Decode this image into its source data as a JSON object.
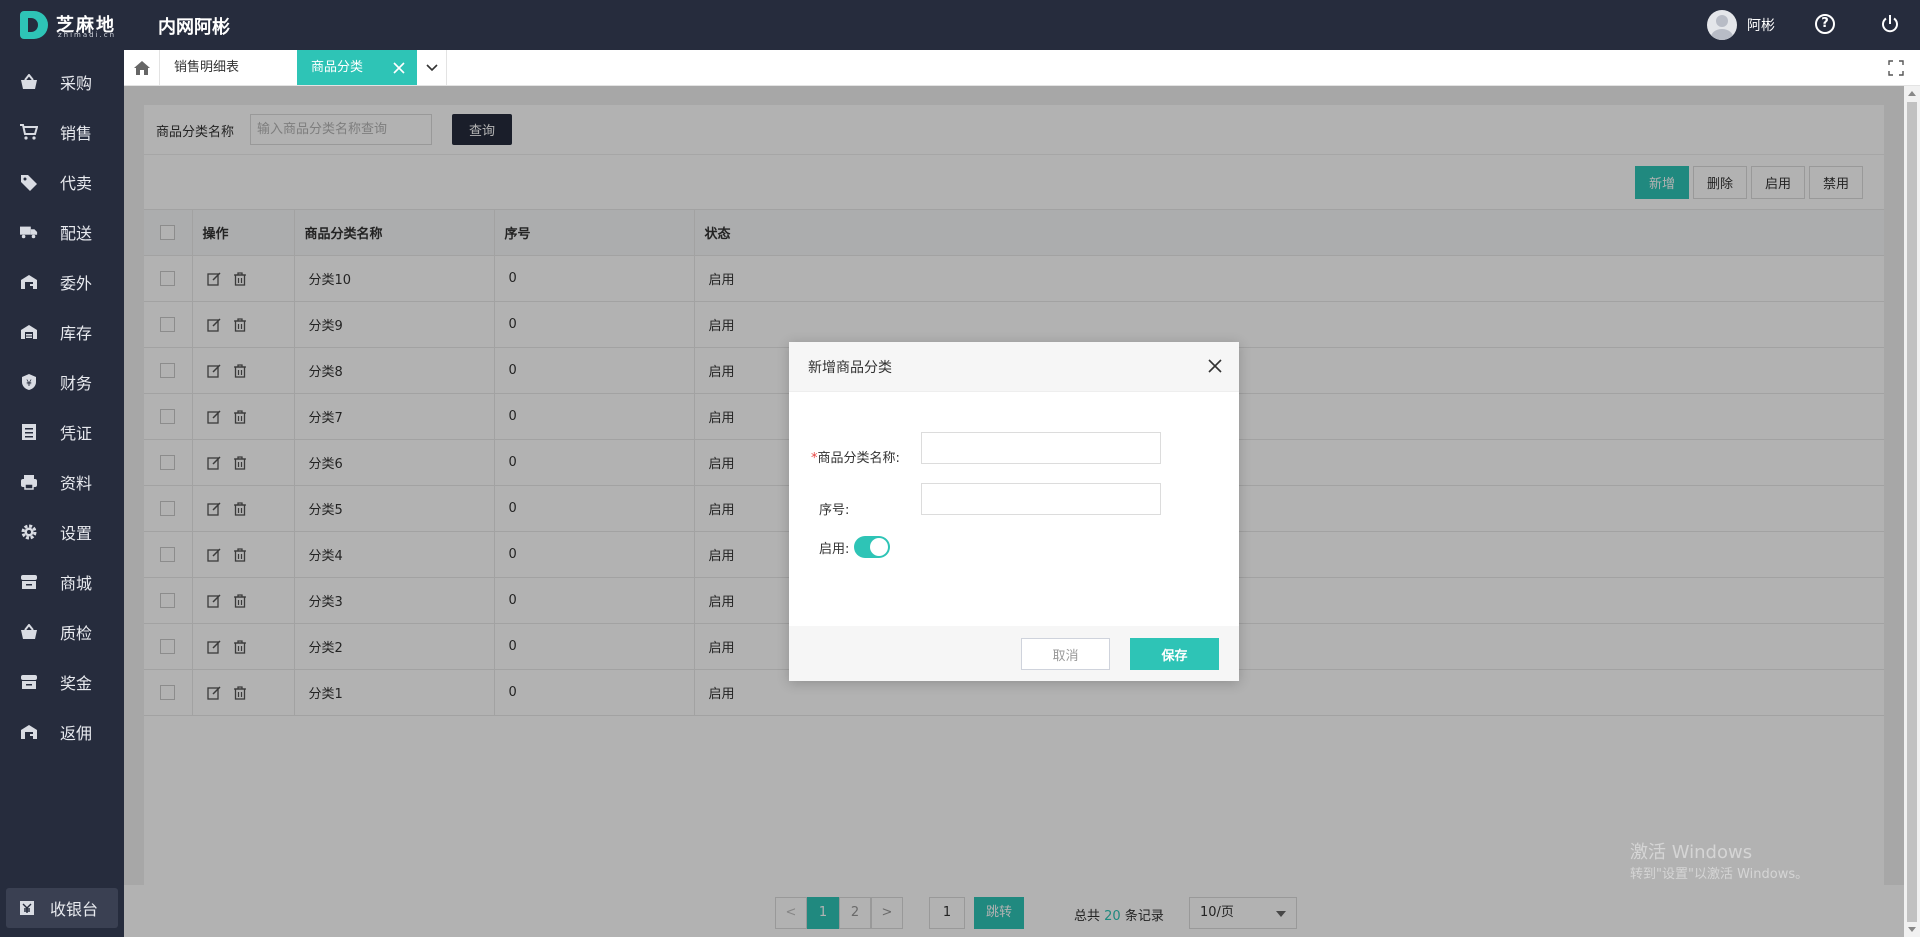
{
  "header": {
    "logo_text": "芝麻地",
    "logo_sub": "zhimadi.cn",
    "system_title": "内网阿彬",
    "username": "阿彬",
    "help_glyph": "?"
  },
  "sidebar": {
    "items": [
      {
        "label": "采购",
        "icon": "basket-icon"
      },
      {
        "label": "销售",
        "icon": "cart-icon"
      },
      {
        "label": "代卖",
        "icon": "tag-icon"
      },
      {
        "label": "配送",
        "icon": "truck-icon"
      },
      {
        "label": "委外",
        "icon": "warehouse-out-icon"
      },
      {
        "label": "库存",
        "icon": "warehouse-icon"
      },
      {
        "label": "财务",
        "icon": "finance-shield-icon"
      },
      {
        "label": "凭证",
        "icon": "voucher-icon"
      },
      {
        "label": "资料",
        "icon": "printer-icon"
      },
      {
        "label": "设置",
        "icon": "gear-icon"
      },
      {
        "label": "商城",
        "icon": "store-icon"
      },
      {
        "label": "质检",
        "icon": "basket-icon"
      },
      {
        "label": "奖金",
        "icon": "store-icon"
      },
      {
        "label": "返佣",
        "icon": "warehouse-out-icon"
      }
    ],
    "cashier_label": "收银台"
  },
  "tabs": {
    "items": [
      {
        "label": "销售明细表",
        "active": false
      },
      {
        "label": "商品分类",
        "active": true
      }
    ]
  },
  "filter": {
    "label": "商品分类名称",
    "placeholder": "输入商品分类名称查询",
    "query_label": "查询"
  },
  "toolbar": {
    "add_label": "新增",
    "delete_label": "删除",
    "enable_label": "启用",
    "disable_label": "禁用"
  },
  "table": {
    "headers": {
      "op": "操作",
      "name": "商品分类名称",
      "seq": "序号",
      "status": "状态"
    },
    "rows": [
      {
        "name": "分类10",
        "seq": "0",
        "status": "启用"
      },
      {
        "name": "分类9",
        "seq": "0",
        "status": "启用"
      },
      {
        "name": "分类8",
        "seq": "0",
        "status": "启用"
      },
      {
        "name": "分类7",
        "seq": "0",
        "status": "启用"
      },
      {
        "name": "分类6",
        "seq": "0",
        "status": "启用"
      },
      {
        "name": "分类5",
        "seq": "0",
        "status": "启用"
      },
      {
        "name": "分类4",
        "seq": "0",
        "status": "启用"
      },
      {
        "name": "分类3",
        "seq": "0",
        "status": "启用"
      },
      {
        "name": "分类2",
        "seq": "0",
        "status": "启用"
      },
      {
        "name": "分类1",
        "seq": "0",
        "status": "启用"
      }
    ]
  },
  "pager": {
    "prev": "<",
    "next": ">",
    "pages": [
      "1",
      "2"
    ],
    "current": "1",
    "jump_value": "1",
    "jump_label": "跳转",
    "total_prefix": "总共",
    "total_count": "20",
    "total_suffix": "条记录",
    "page_size": "10/页"
  },
  "modal": {
    "title": "新增商品分类",
    "name_label": "商品分类名称:",
    "required_mark": "*",
    "seq_label": "序号:",
    "enabled_label": "启用:",
    "enabled": true,
    "cancel_label": "取消",
    "save_label": "保存"
  },
  "watermark": {
    "line1": "激活 Windows",
    "line2": "转到\"设置\"以激活 Windows。"
  },
  "colors": {
    "accent": "#2ec4b6",
    "nav_bg": "#262c3d",
    "required": "#e64340"
  }
}
